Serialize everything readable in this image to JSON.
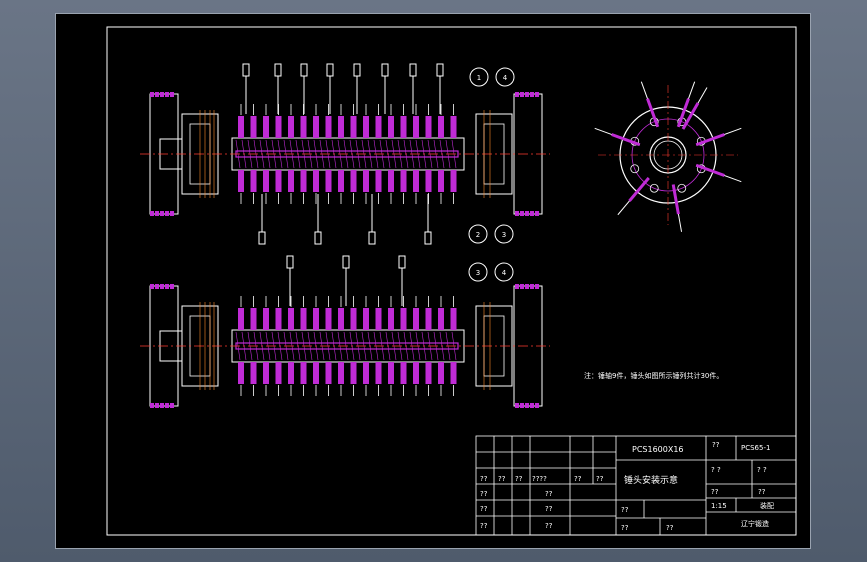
{
  "colors": {
    "frame": "#ffffff",
    "part_magenta": "#c02bd6",
    "centerline": "#ff3b2f",
    "hammer_outline": "#ffffff",
    "shaft_fill": "#a020b8",
    "background": "#000000",
    "viewport": "#5b6779"
  },
  "section_markers": {
    "top": [
      "1",
      "4"
    ],
    "middle": [
      "2",
      "3"
    ],
    "bottom": [
      "3",
      "4"
    ]
  },
  "note_text": "注：锤轴9件，锤头如图所示锤列共计30件。",
  "title_block": {
    "model": "PCS1600X16",
    "drawing_no": "PCS65-1",
    "drawing_title": "锤头安装示意",
    "company": "辽宁锻造",
    "scale": "1:15",
    "material": "装配",
    "unknown": "??",
    "unknown_q": "? ?",
    "unknown_long": "????",
    "unknown_dot": "?.?",
    "pair": "? ?"
  }
}
